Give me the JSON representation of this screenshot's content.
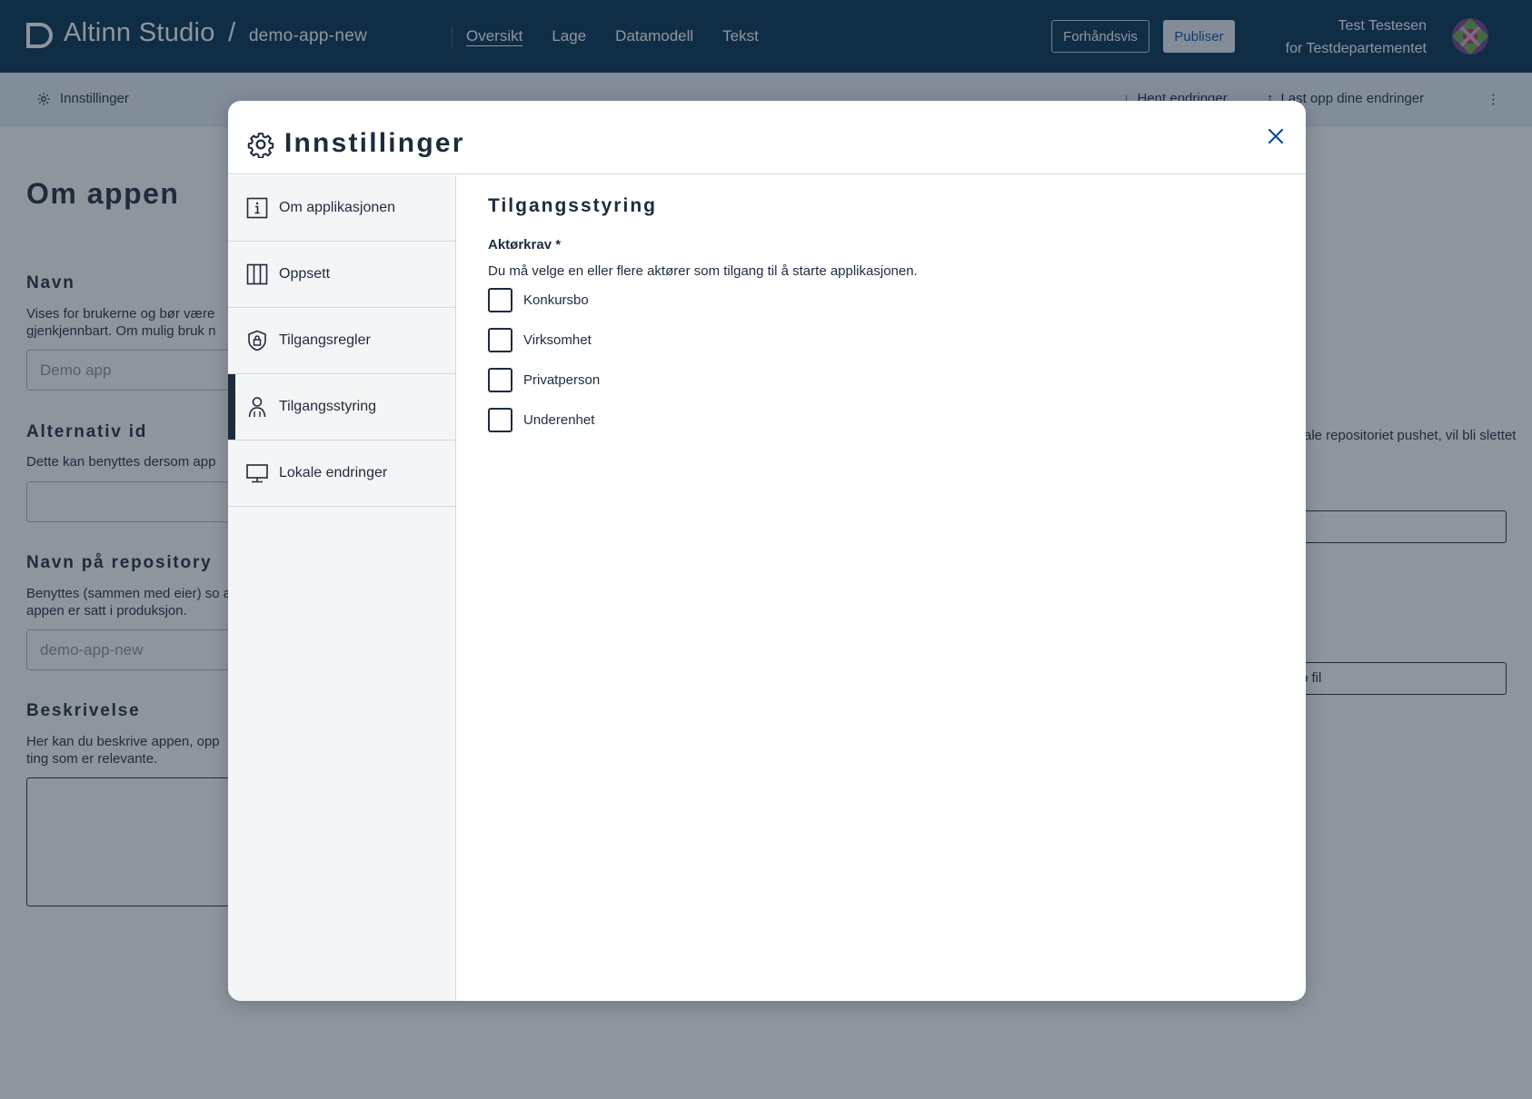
{
  "header": {
    "brand": "Altinn Studio",
    "separator": "/",
    "repo": "demo-app-new",
    "nav": [
      "Oversikt",
      "Lage",
      "Datamodell",
      "Tekst"
    ],
    "active_nav": "Oversikt",
    "preview_label": "Forhåndsvis",
    "publish_label": "Publiser",
    "user_name": "Test Testesen",
    "user_org": "for Testdepartementet"
  },
  "subbar": {
    "settings_label": "Innstillinger",
    "fetch_label": "Hent endringer",
    "upload_label": "Last opp dine endringer",
    "more_icon": "⋮"
  },
  "background": {
    "title": "Om appen",
    "name_heading": "Navn",
    "name_desc": "Vises for brukerne og bør være gjenkjennbart. Om mulig bruk n",
    "name_placeholder": "Demo app",
    "altid_heading": "Alternativ id",
    "altid_desc": "Dette kan benyttes dersom app",
    "repo_heading": "Navn på repository",
    "repo_desc": "Benyttes (sammen med eier) so at appen er satt i produksjon.",
    "repo_placeholder": "demo-app-new",
    "desc_heading": "Beskrivelse",
    "desc_desc": "Her kan du beskrive appen, opp ting som er relevante.",
    "right_text": "rale repositoriet pushet, vil bli slettet",
    "right_button": "p fil"
  },
  "modal": {
    "title": "Innstillinger",
    "tabs": [
      {
        "label": "Om applikasjonen",
        "icon": "info-icon"
      },
      {
        "label": "Oppsett",
        "icon": "columns-icon"
      },
      {
        "label": "Tilgangsregler",
        "icon": "shield-lock-icon"
      },
      {
        "label": "Tilgangsstyring",
        "icon": "person-icon"
      },
      {
        "label": "Lokale endringer",
        "icon": "monitor-icon"
      }
    ],
    "active_tab": "Tilgangsstyring",
    "content": {
      "title": "Tilgangsstyring",
      "field_label": "Aktørkrav *",
      "field_desc": "Du må velge en eller flere aktører som tilgang til å starte applikasjonen.",
      "options": [
        {
          "label": "Konkursbo",
          "checked": false
        },
        {
          "label": "Virksomhet",
          "checked": false
        },
        {
          "label": "Privatperson",
          "checked": false
        },
        {
          "label": "Underenhet",
          "checked": false
        }
      ]
    }
  },
  "colors": {
    "header_bg": "#022f51",
    "subbar_bg": "#e6eef8",
    "text": "#1e2b3c",
    "accent": "#0a4c9a"
  }
}
